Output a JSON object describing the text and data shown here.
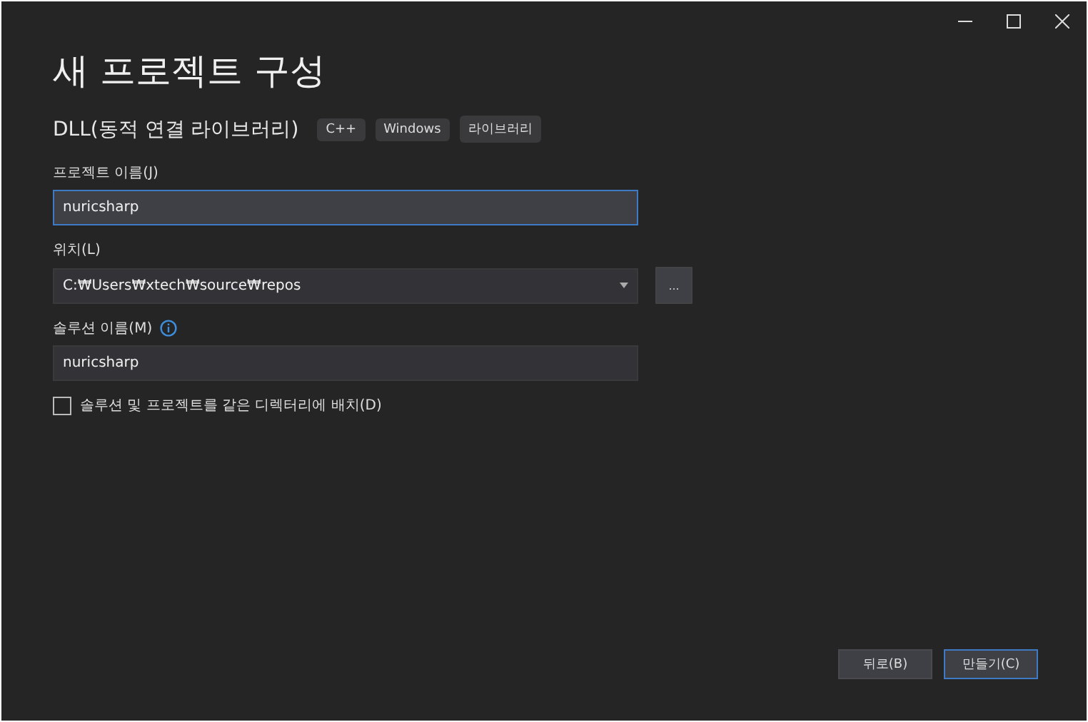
{
  "window": {
    "controls": [
      {
        "kind": "minimize"
      },
      {
        "kind": "maximize"
      },
      {
        "kind": "close"
      }
    ]
  },
  "title": "새 프로젝트 구성",
  "template": {
    "name": "DLL(동적 연결 라이브러리)",
    "tags": [
      "C++",
      "Windows",
      "라이브러리"
    ]
  },
  "fields": [
    {
      "kind": "text",
      "label": "프로젝트 이름(J)",
      "value": "nuricsharp",
      "focused": true,
      "info": false
    },
    {
      "kind": "combo",
      "label": "위치(L)",
      "value": "C:₩Users₩xtech₩source₩repos",
      "focused": false,
      "info": false,
      "browse": "..."
    },
    {
      "kind": "text",
      "label": "솔루션 이름(M)",
      "value": "nuricsharp",
      "focused": false,
      "info": true
    }
  ],
  "checkbox": {
    "label": "솔루션 및 프로젝트를 같은 디렉터리에 배치(D)",
    "checked": false
  },
  "buttons": [
    {
      "label": "뒤로(B)",
      "default": false
    },
    {
      "label": "만들기(C)",
      "default": true
    }
  ]
}
